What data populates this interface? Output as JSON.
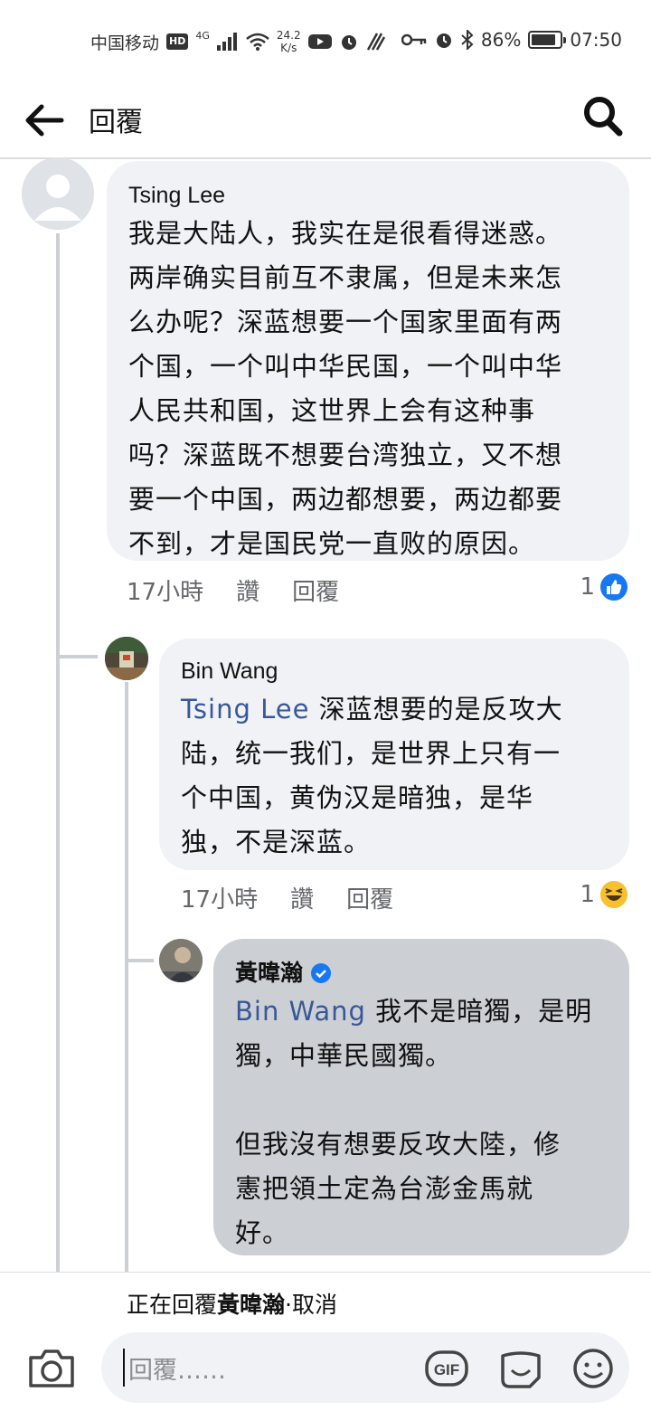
{
  "status_bar": {
    "carrier": "中国移动",
    "hd": "HD",
    "network": "4G",
    "speed_value": "24.2",
    "speed_unit": "K/s",
    "battery": "86%",
    "time": "07:50"
  },
  "header": {
    "title": "回覆"
  },
  "comments": [
    {
      "author": "Tsing Lee",
      "text": "我是大陆人，我实在是很看得迷惑。\n两岸确实目前互不隶属，但是未来怎\n么办呢？深蓝想要一个国家里面有两\n个国，一个叫中华民国，一个叫中华\n人民共和国，这世界上会有这种事\n吗？深蓝既不想要台湾独立，又不想\n要一个中国，两边都想要，两边都要\n不到，才是国民党一直败的原因。",
      "time": "17小時",
      "like_label": "讚",
      "reply_label": "回覆",
      "reaction_count": "1"
    },
    {
      "author": "Bin Wang",
      "mention": "Tsing Lee",
      "text": " 深蓝想要的是反攻大\n陆，统一我们，是世界上只有一\n个中国，黄伪汉是暗独，是华\n独，不是深蓝。",
      "time": "17小時",
      "like_label": "讚",
      "reply_label": "回覆",
      "reaction_count": "1"
    },
    {
      "author": "黃暐瀚",
      "mention": "Bin Wang",
      "text": " 我不是暗獨，是明\n獨，中華民國獨。\n\n但我沒有想要反攻大陸，修\n憲把領土定為台澎金馬就\n好。"
    }
  ],
  "composer": {
    "replying_prefix": "正在回覆",
    "replying_name": "黃暐瀚",
    "separator": "·",
    "cancel": "取消",
    "placeholder": "回覆……",
    "gif": "GIF"
  },
  "colors": {
    "accent": "#1877f2",
    "mention": "#385898",
    "bubble": "#f0f2f5",
    "bubble_selected": "#ccd0d5"
  }
}
